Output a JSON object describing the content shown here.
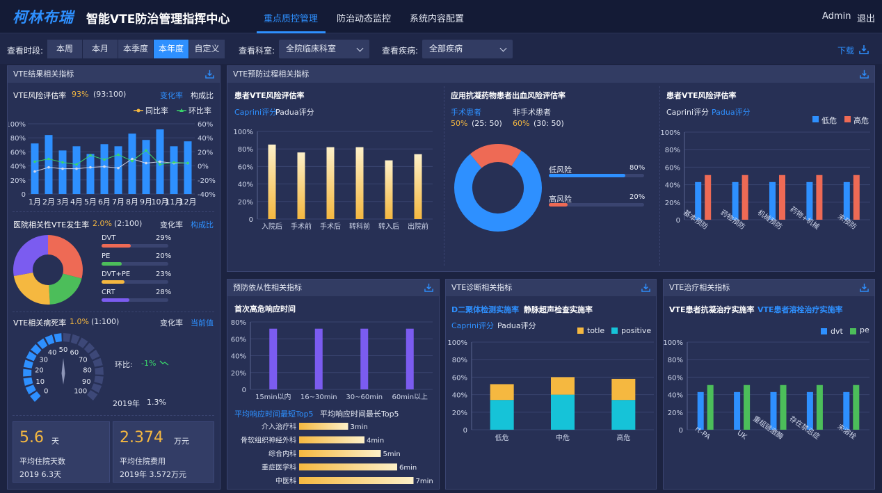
{
  "app": {
    "logo": "柯林布瑞",
    "title": "智能VTE防治管理指挥中心",
    "nav": [
      "重点质控管理",
      "防治动态监控",
      "系统内容配置"
    ],
    "user": "Admin",
    "logout": "退出"
  },
  "filters": {
    "time_label": "查看时段:",
    "time_options": [
      "本周",
      "本月",
      "本季度",
      "本年度",
      "自定义"
    ],
    "time_selected": "本年度",
    "dept_label": "查看科室:",
    "dept_value": "全院临床科室",
    "disease_label": "查看疾病:",
    "disease_value": "全部疾病",
    "download": "下载"
  },
  "left_panel": {
    "title": "VTE结果相关指标",
    "risk": {
      "label": "VTE风险评估率",
      "rate": "93%",
      "ratio": "(93:100)",
      "tab1": "变化率",
      "tab2": "构成比",
      "legend_yoy": "同比率",
      "legend_mom": "环比率",
      "chart_data": {
        "type": "bar",
        "categories": [
          "1月",
          "2月",
          "3月",
          "4月",
          "5月",
          "6月",
          "7月",
          "8月",
          "9月",
          "10月",
          "11月",
          "12月"
        ],
        "values": [
          72,
          84,
          62,
          68,
          57,
          71,
          68,
          86,
          77,
          92,
          68,
          75
        ],
        "yoy": [
          -8,
          -2,
          -4,
          -4,
          -2,
          -1,
          -3,
          10,
          4,
          6,
          4,
          4
        ],
        "mom": [
          6,
          10,
          5,
          2,
          15,
          9,
          16,
          7,
          22,
          2,
          5,
          4
        ],
        "ylim": [
          0,
          100
        ],
        "y_ticks": [
          "100%",
          "80%",
          "60%",
          "40%",
          "20%",
          "0"
        ],
        "y2_ticks": [
          "60%",
          "40%",
          "20%",
          "0%",
          "-20%",
          "-40%"
        ]
      }
    },
    "hosp": {
      "label": "医院相关性VTE发生率",
      "rate": "2.0%",
      "ratio": "(2:100)",
      "tab1": "变化率",
      "tab2": "构成比",
      "items": [
        {
          "name": "DVT",
          "pct": "29%",
          "value": 29,
          "color": "#ee6a55"
        },
        {
          "name": "PE",
          "pct": "20%",
          "value": 20,
          "color": "#4cbe5a"
        },
        {
          "name": "DVT+PE",
          "pct": "23%",
          "value": 23,
          "color": "#f5b840"
        },
        {
          "name": "CRT",
          "pct": "28%",
          "value": 28,
          "color": "#7b5cf0"
        }
      ]
    },
    "death": {
      "label": "VTE相关病死率",
      "rate": "1.0%",
      "ratio": "(1:100)",
      "tab1": "变化率",
      "tab2": "当前值",
      "gauge_ticks": [
        "0",
        "10",
        "20",
        "30",
        "40",
        "50",
        "60",
        "70",
        "80",
        "90",
        "100"
      ],
      "huanbi_label": "环比:",
      "huanbi_value": "-1%",
      "year": "2019年",
      "year_value": "1.3%"
    },
    "stats": [
      {
        "value": "5.6",
        "unit": "天",
        "label": "平均住院天数",
        "sub": "2019  6.3天"
      },
      {
        "value": "2.374",
        "unit": "万元",
        "label": "平均住院费用",
        "sub": "2019年  3.572万元"
      }
    ]
  },
  "proc_panel": {
    "title": "VTE预防过程相关指标",
    "c1": {
      "title": "患者VTE风险评估率",
      "tab1": "Caprini评分",
      "tab2": "Padua评分",
      "chart_data": {
        "type": "bar",
        "categories": [
          "入院后",
          "手术前",
          "手术后",
          "转科前",
          "转入后",
          "出院前"
        ],
        "values": [
          85,
          76,
          82,
          82,
          67,
          74
        ],
        "ylim": [
          0,
          100
        ],
        "y_ticks": [
          "100%",
          "80%",
          "60%",
          "40%",
          "20%",
          "0"
        ]
      }
    },
    "c2": {
      "title": "应用抗凝药物患者出血风险评估率",
      "surg": "手术患者",
      "nonsurg": "非手术患者",
      "surg_v": "50%",
      "surg_r": "(25:  50)",
      "nonsurg_v": "60%",
      "nonsurg_r": "(30:  50)",
      "chart_data": {
        "type": "pie",
        "labels": [
          "低风险",
          "高风险"
        ],
        "values": [
          80,
          20
        ],
        "pcts": [
          "80%",
          "20%"
        ]
      }
    },
    "c3": {
      "title": "患者VTE风险评估率",
      "tab1": "Caprini评分",
      "tab2": "Padua评分",
      "legend_low": "低危",
      "legend_high": "高危",
      "chart_data": {
        "type": "bar",
        "categories": [
          "基本预防",
          "药物预防",
          "机械预防",
          "药物+机械",
          "未预防"
        ],
        "series": [
          {
            "name": "低危",
            "values": [
              43,
              43,
              43,
              43,
              43
            ]
          },
          {
            "name": "高危",
            "values": [
              51,
              51,
              51,
              51,
              51
            ]
          }
        ],
        "ylim": [
          0,
          100
        ],
        "y_ticks": [
          "100%",
          "80%",
          "60%",
          "40%",
          "20%",
          "0"
        ]
      }
    }
  },
  "comp_panel": {
    "title": "预防依从性相关指标",
    "sub": "首次高危响应时间",
    "chart_data": {
      "type": "bar",
      "categories": [
        "15min以内",
        "16~30min",
        "30~60min",
        "60min以上"
      ],
      "values": [
        72,
        72,
        72,
        72
      ],
      "ylim": [
        0,
        80
      ],
      "y_ticks": [
        "80%",
        "60%",
        "40%",
        "20%",
        "0"
      ]
    },
    "tab1": "平均响应时间最短Top5",
    "tab2": "平均响应时间最长Top5",
    "top5": [
      {
        "name": "介入治疗科",
        "label": "3min",
        "value": 3
      },
      {
        "name": "骨软组织神经外科",
        "label": "4min",
        "value": 4
      },
      {
        "name": "综合内科",
        "label": "5min",
        "value": 5
      },
      {
        "name": "重症医学科",
        "label": "6min",
        "value": 6
      },
      {
        "name": "中医科",
        "label": "7min",
        "value": 7
      }
    ]
  },
  "diag_panel": {
    "title": "VTE诊断相关指标",
    "tab1": "D二聚体检测实施率",
    "tab2": "静脉超声检查实施率",
    "sub1": "Caprini评分",
    "sub2": "Padua评分",
    "legend_a": "totle",
    "legend_b": "positive",
    "chart_data": {
      "type": "bar",
      "categories": [
        "低危",
        "中危",
        "高危"
      ],
      "series": [
        {
          "name": "positive",
          "values": [
            34,
            40,
            34
          ]
        },
        {
          "name": "totle",
          "values": [
            18,
            20,
            24
          ]
        }
      ],
      "ylim": [
        0,
        100
      ],
      "y_ticks": [
        "100%",
        "80%",
        "60%",
        "40%",
        "20%",
        "0"
      ]
    }
  },
  "treat_panel": {
    "title": "VTE治疗相关指标",
    "tab1": "VTE患者抗凝治疗实施率",
    "tab2": "VTE患者溶栓治疗实施率",
    "legend_a": "dvt",
    "legend_b": "pe",
    "chart_data": {
      "type": "bar",
      "categories": [
        "rt-PA",
        "UK",
        "重组链激酶",
        "存在禁忌症",
        "未溶栓"
      ],
      "series": [
        {
          "name": "dvt",
          "values": [
            43,
            43,
            43,
            43,
            43
          ]
        },
        {
          "name": "pe",
          "values": [
            51,
            51,
            51,
            51,
            51
          ]
        }
      ],
      "ylim": [
        0,
        100
      ],
      "y_ticks": [
        "100%",
        "80%",
        "60%",
        "40%",
        "20%",
        "0"
      ]
    }
  }
}
